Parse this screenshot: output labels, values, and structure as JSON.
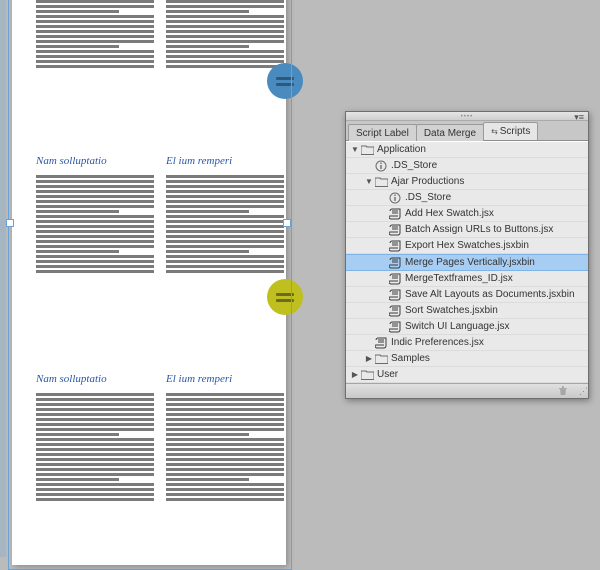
{
  "document": {
    "headings": {
      "left": "Nam solluptatio",
      "right": "El ium remperi"
    }
  },
  "panel": {
    "tabs": [
      {
        "label": "Script Label",
        "active": false
      },
      {
        "label": "Data Merge",
        "active": false
      },
      {
        "label": "Scripts",
        "active": true,
        "linked": true
      }
    ],
    "tree": [
      {
        "depth": 0,
        "icon": "folder",
        "label": "Application",
        "tw": "down"
      },
      {
        "depth": 1,
        "icon": "info",
        "label": ".DS_Store"
      },
      {
        "depth": 1,
        "icon": "folder",
        "label": "Ajar Productions",
        "tw": "down"
      },
      {
        "depth": 2,
        "icon": "info",
        "label": ".DS_Store"
      },
      {
        "depth": 2,
        "icon": "script",
        "label": "Add Hex Swatch.jsx"
      },
      {
        "depth": 2,
        "icon": "script",
        "label": "Batch Assign URLs to Buttons.jsx"
      },
      {
        "depth": 2,
        "icon": "script",
        "label": "Export Hex Swatches.jsxbin"
      },
      {
        "depth": 2,
        "icon": "script",
        "label": "Merge Pages Vertically.jsxbin",
        "selected": true
      },
      {
        "depth": 2,
        "icon": "script",
        "label": "MergeTextframes_ID.jsx"
      },
      {
        "depth": 2,
        "icon": "script",
        "label": "Save Alt Layouts as Documents.jsxbin"
      },
      {
        "depth": 2,
        "icon": "script",
        "label": "Sort Swatches.jsxbin"
      },
      {
        "depth": 2,
        "icon": "script",
        "label": "Switch UI Language.jsx"
      },
      {
        "depth": 1,
        "icon": "script",
        "label": "Indic Preferences.jsx"
      },
      {
        "depth": 1,
        "icon": "folder",
        "label": "Samples",
        "tw": "right"
      },
      {
        "depth": 0,
        "icon": "folder",
        "label": "User",
        "tw": "right"
      }
    ]
  }
}
